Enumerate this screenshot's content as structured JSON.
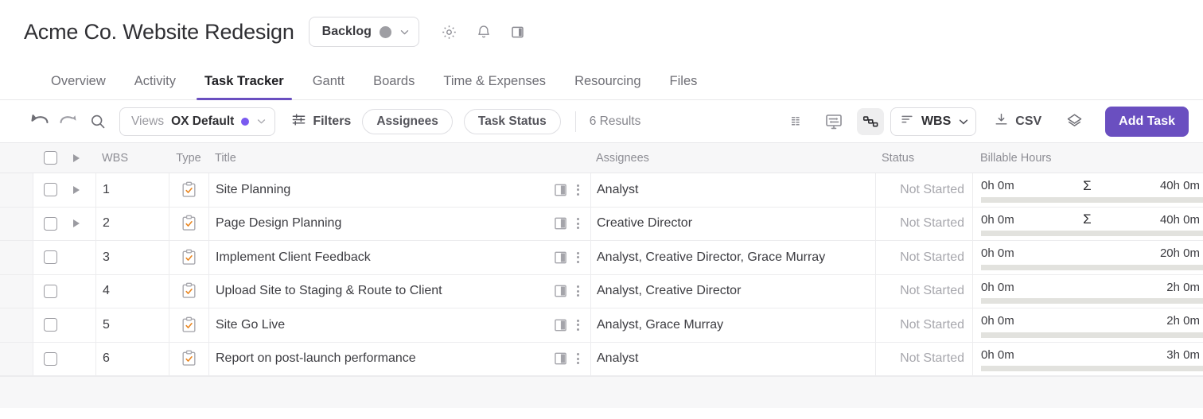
{
  "header": {
    "project_title": "Acme Co. Website Redesign",
    "status_pill": {
      "label": "Backlog",
      "dot_color": "#9e9ea3",
      "chevron_icon": "chevron-down-icon"
    },
    "icons": [
      {
        "name": "gear-icon",
        "label": "Settings"
      },
      {
        "name": "bell-icon",
        "label": "Notifications"
      },
      {
        "name": "side-panel-icon",
        "label": "Toggle Panel"
      }
    ]
  },
  "tabs": [
    {
      "label": "Overview",
      "active": false
    },
    {
      "label": "Activity",
      "active": false
    },
    {
      "label": "Task Tracker",
      "active": true
    },
    {
      "label": "Gantt",
      "active": false
    },
    {
      "label": "Boards",
      "active": false
    },
    {
      "label": "Time & Expenses",
      "active": false
    },
    {
      "label": "Resourcing",
      "active": false
    },
    {
      "label": "Files",
      "active": false
    }
  ],
  "toolbar": {
    "undo_icon": "undo-icon",
    "redo_icon": "redo-icon",
    "search_icon": "search-icon",
    "views": {
      "key_label": "Views",
      "value_label": "OX Default",
      "dot_color": "#7a5af0"
    },
    "filters_label": "Filters",
    "chips": [
      "Assignees",
      "Task Status"
    ],
    "results_label": "6 Results",
    "view_icons": [
      {
        "name": "column-density-icon",
        "active": false
      },
      {
        "name": "display-settings-icon",
        "active": false
      },
      {
        "name": "dependencies-icon",
        "active": true
      }
    ],
    "sort": {
      "label": "WBS",
      "icon": "sort-icon",
      "chevron_icon": "chevron-down-icon"
    },
    "csv_label": "CSV",
    "csv_icon": "download-icon",
    "layers_icon": "layers-icon",
    "add_task_label": "Add Task",
    "accent_color": "#6a4fc0"
  },
  "table": {
    "columns": {
      "wbs": "WBS",
      "type": "Type",
      "title": "Title",
      "assignees": "Assignees",
      "status": "Status",
      "billable_hours": "Billable Hours"
    },
    "rows": [
      {
        "wbs": "1",
        "expandable": true,
        "type_icon": "task-clipboard-icon",
        "title": "Site Planning",
        "assignees": "Analyst",
        "status": "Not Started",
        "hours_logged": "0h 0m",
        "sigma": "Σ",
        "hours_total": "40h 0m"
      },
      {
        "wbs": "2",
        "expandable": true,
        "type_icon": "task-clipboard-icon",
        "title": "Page Design Planning",
        "assignees": "Creative Director",
        "status": "Not Started",
        "hours_logged": "0h 0m",
        "sigma": "Σ",
        "hours_total": "40h 0m"
      },
      {
        "wbs": "3",
        "expandable": false,
        "type_icon": "task-clipboard-icon",
        "title": "Implement Client Feedback",
        "assignees": "Analyst, Creative Director, Grace Murray",
        "status": "Not Started",
        "hours_logged": "0h 0m",
        "sigma": "",
        "hours_total": "20h 0m"
      },
      {
        "wbs": "4",
        "expandable": false,
        "type_icon": "task-clipboard-icon",
        "title": "Upload Site to Staging & Route to Client",
        "assignees": "Analyst, Creative Director",
        "status": "Not Started",
        "hours_logged": "0h 0m",
        "sigma": "",
        "hours_total": "2h 0m"
      },
      {
        "wbs": "5",
        "expandable": false,
        "type_icon": "task-clipboard-icon",
        "title": "Site Go Live",
        "assignees": "Analyst, Grace Murray",
        "status": "Not Started",
        "hours_logged": "0h 0m",
        "sigma": "",
        "hours_total": "2h 0m"
      },
      {
        "wbs": "6",
        "expandable": false,
        "type_icon": "task-clipboard-icon",
        "title": "Report on post-launch performance",
        "assignees": "Analyst",
        "status": "Not Started",
        "hours_logged": "0h 0m",
        "sigma": "",
        "hours_total": "3h 0m"
      }
    ]
  }
}
